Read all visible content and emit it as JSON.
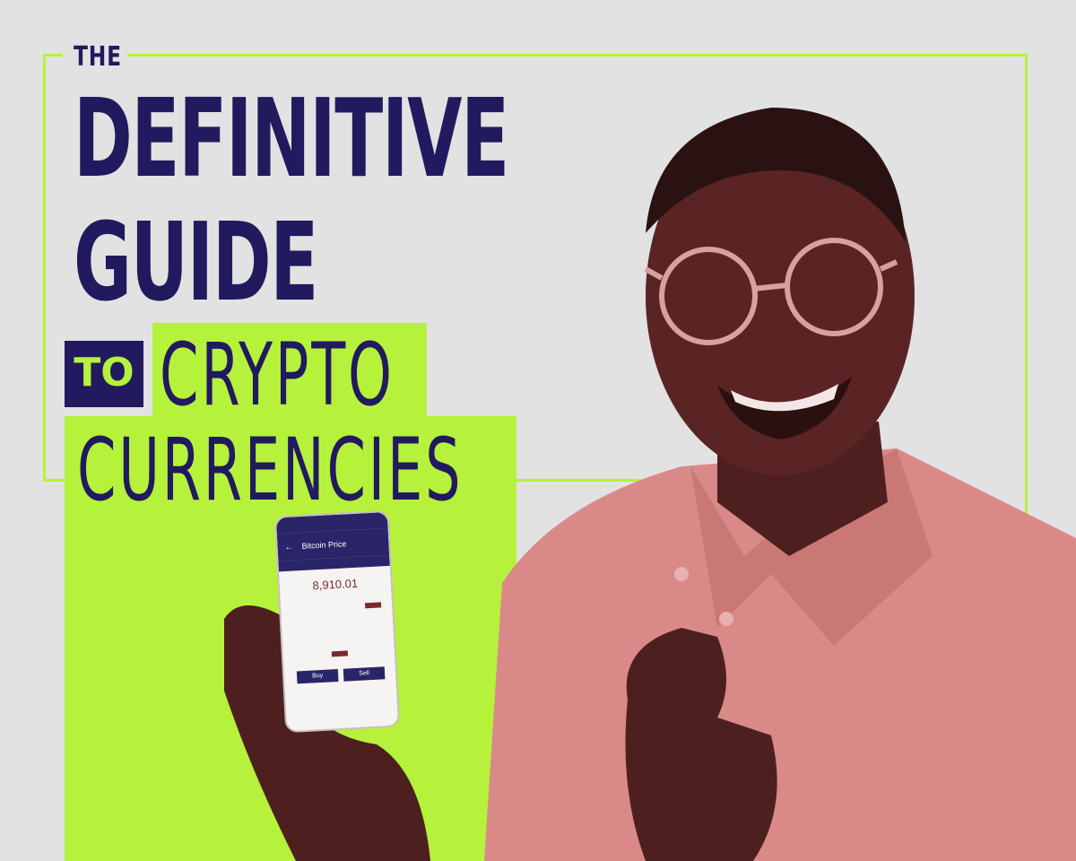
{
  "title": {
    "the": "THE",
    "line1": "DEFINITIVE",
    "line2": "GUIDE",
    "to": "TO",
    "line3": "CRYPTO",
    "line4": "CURRENCIES"
  },
  "phone": {
    "header": "Bitcoin Price",
    "price": "8,910.01",
    "buy_label": "Buy",
    "sell_label": "Sell"
  },
  "colors": {
    "navy": "#211a5e",
    "lime": "#b6f23c",
    "background": "#e2e2e2",
    "shirt": "#d98a88",
    "skin": "#5a2424"
  }
}
